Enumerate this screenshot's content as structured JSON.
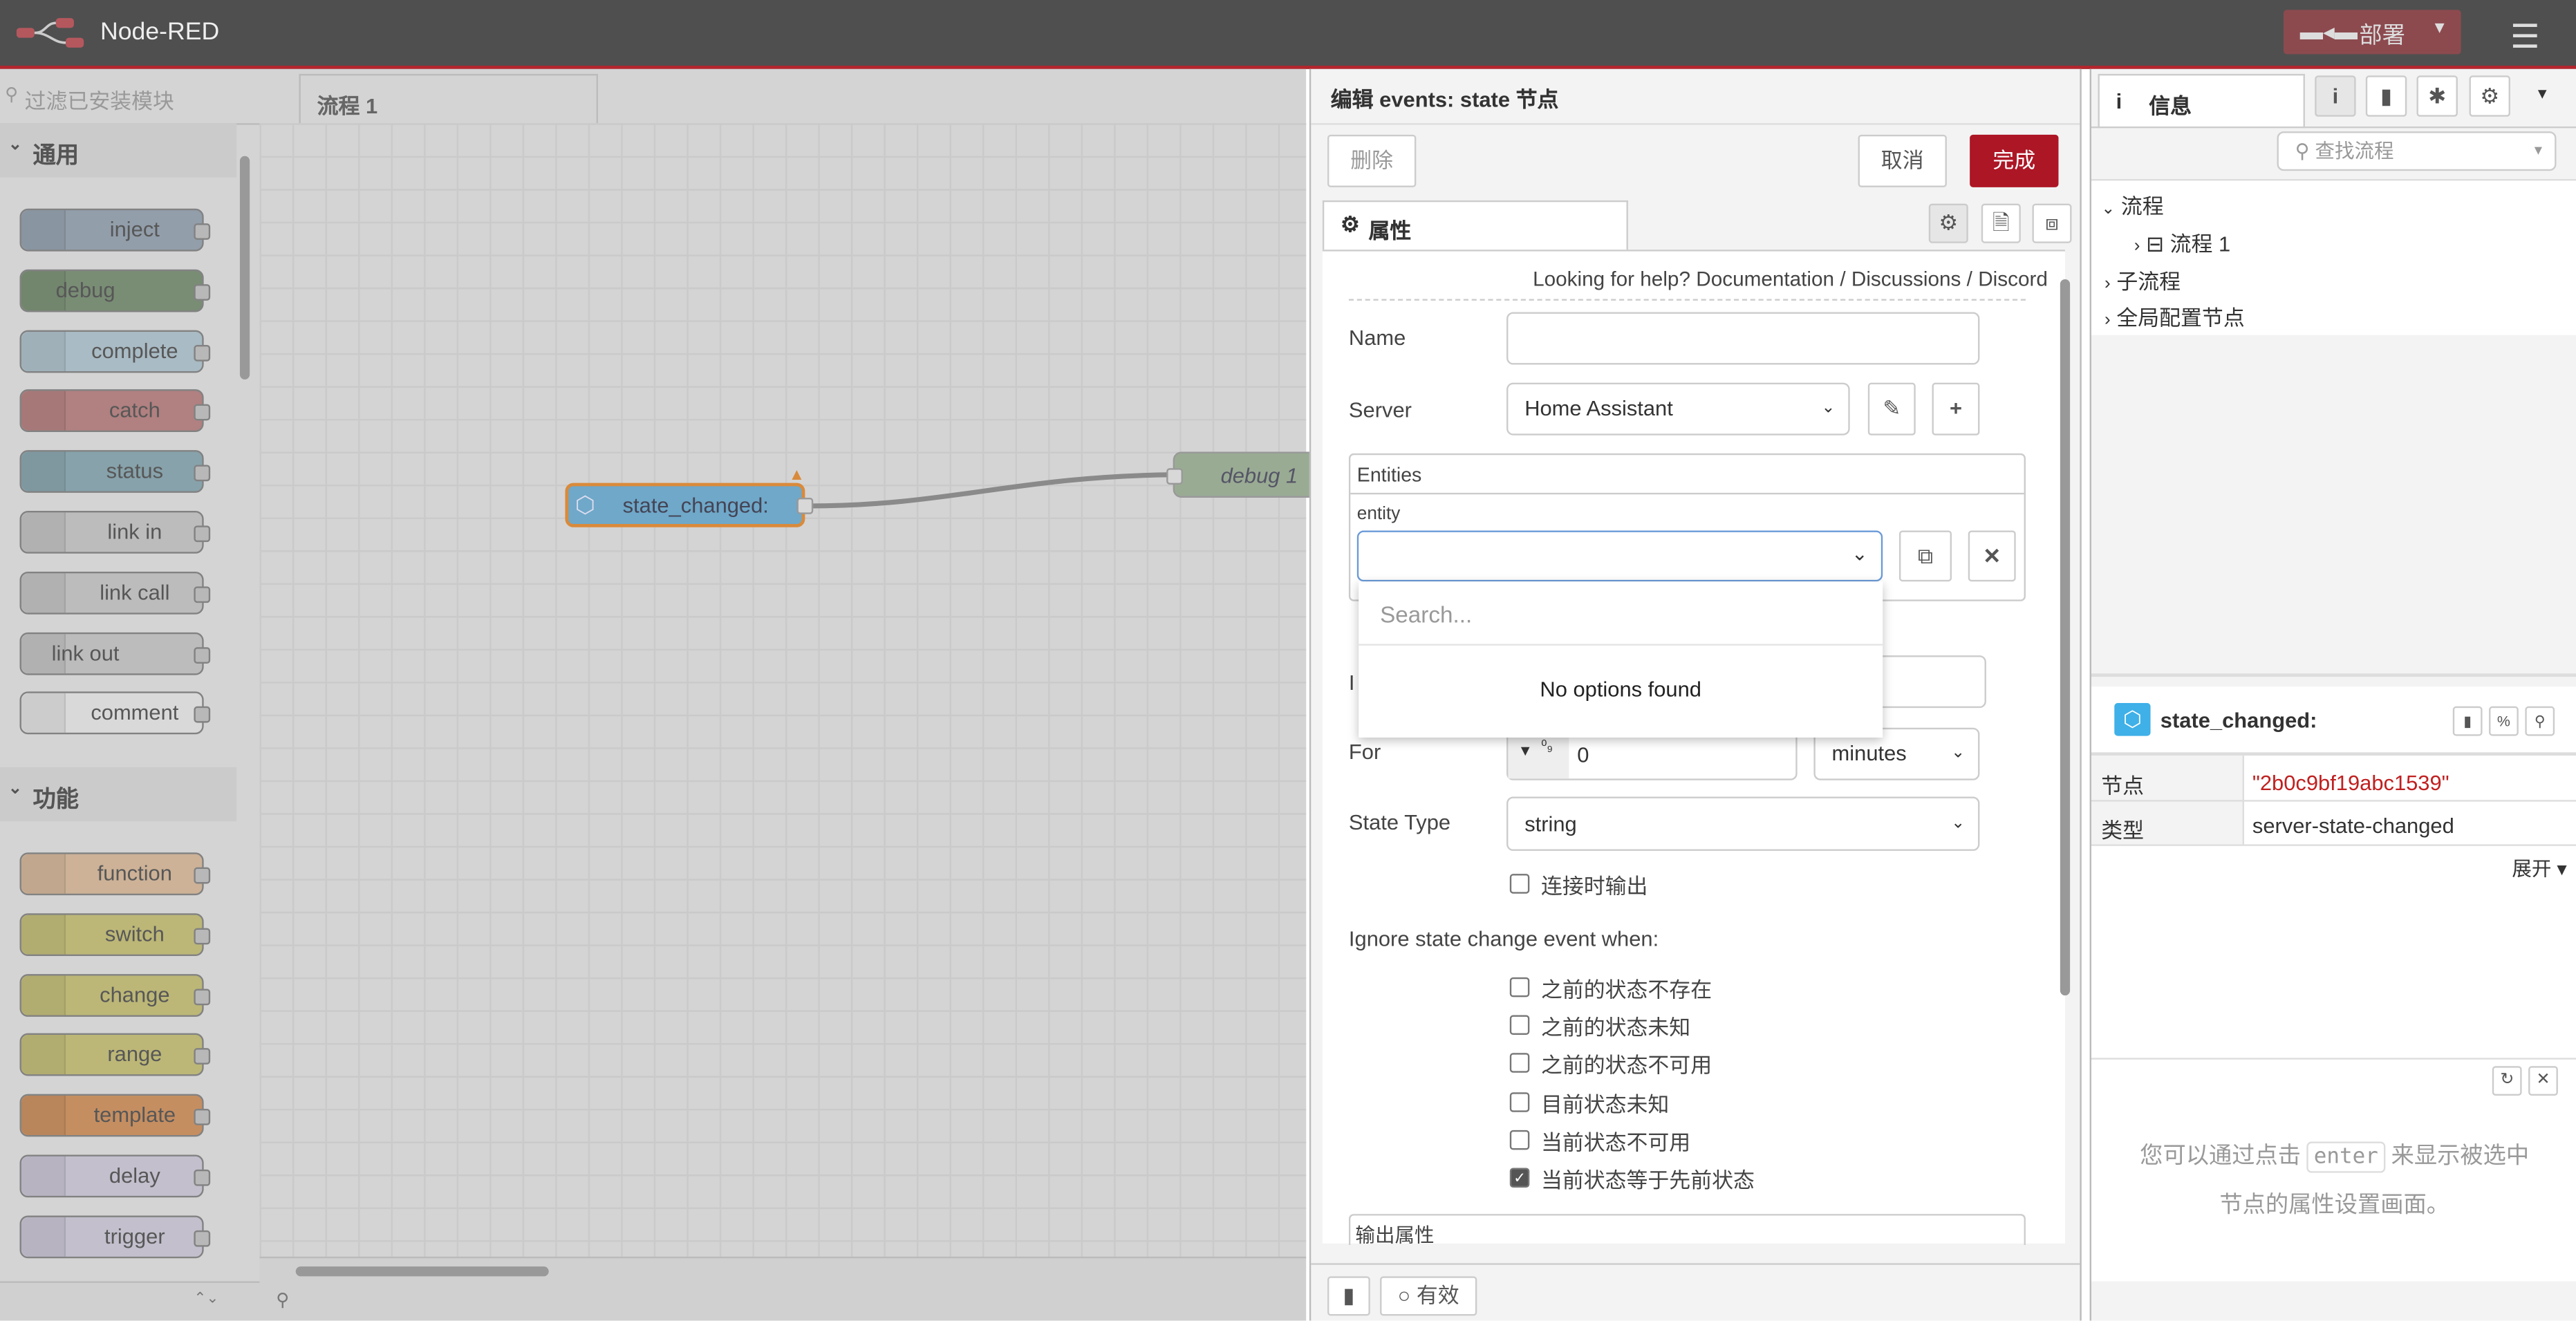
{
  "header": {
    "app_title": "Node-RED",
    "deploy_label": "部署",
    "brand_color": "#8c4a4f"
  },
  "palette": {
    "search_placeholder": "过滤已安装模块",
    "categories": [
      {
        "label": "通用"
      },
      {
        "label": "功能"
      }
    ],
    "common_nodes": [
      {
        "label": "inject",
        "color": "#a6bbcf"
      },
      {
        "label": "debug",
        "color": "#87a980"
      },
      {
        "label": "complete",
        "color": "#c0deed"
      },
      {
        "label": "catch",
        "color": "#e49191"
      },
      {
        "label": "status",
        "color": "#94c1d0"
      },
      {
        "label": "link in",
        "color": "#dddddd"
      },
      {
        "label": "link call",
        "color": "#dddddd"
      },
      {
        "label": "link out",
        "color": "#dddddd"
      },
      {
        "label": "comment",
        "color": "#ffffff"
      }
    ],
    "function_nodes": [
      {
        "label": "function",
        "color": "#fdd0a2"
      },
      {
        "label": "switch",
        "color": "#e2d96e"
      },
      {
        "label": "change",
        "color": "#e2d96e"
      },
      {
        "label": "range",
        "color": "#e2d96e"
      },
      {
        "label": "template",
        "color": "#ffa357"
      },
      {
        "label": "delay",
        "color": "#e6e0f8"
      },
      {
        "label": "trigger",
        "color": "#e6e0f8"
      }
    ]
  },
  "workspace": {
    "tab_label": "流程 1",
    "nodes": [
      {
        "label": "state_changed:"
      },
      {
        "label": "debug 1"
      }
    ]
  },
  "editor": {
    "title": "编辑 events: state 节点",
    "delete_label": "删除",
    "cancel_label": "取消",
    "done_label": "完成",
    "tab_properties": "属性",
    "help": {
      "prefix": "Looking for help?",
      "documentation": "Documentation",
      "sep": "/",
      "discussions": "Discussions",
      "discord": "Discord"
    },
    "name_label": "Name",
    "name_value": "",
    "server_label": "Server",
    "server_value": "Home Assistant",
    "entities_label": "Entities",
    "entity_label": "entity",
    "entity_value": "",
    "search_placeholder": "Search...",
    "no_options": "No options found",
    "for_label": "For",
    "for_value": "0",
    "for_unit": "minutes",
    "state_type_label": "State Type",
    "state_type_value": "string",
    "output_on_connect": {
      "label": "连接时输出",
      "checked": false
    },
    "ignore_label": "Ignore state change event when:",
    "ignore_options": [
      {
        "label": "之前的状态不存在",
        "checked": false
      },
      {
        "label": "之前的状态未知",
        "checked": false
      },
      {
        "label": "之前的状态不可用",
        "checked": false
      },
      {
        "label": "目前状态未知",
        "checked": false
      },
      {
        "label": "当前状态不可用",
        "checked": false
      },
      {
        "label": "当前状态等于先前状态",
        "checked": true
      }
    ],
    "output_props_label": "输出属性",
    "enabled_label": "有效"
  },
  "sidebar": {
    "tab_label": "信息",
    "search_placeholder": "查找流程",
    "tree": [
      {
        "label": "流程"
      },
      {
        "label": "流程 1"
      },
      {
        "label": "子流程"
      },
      {
        "label": "全局配置节点"
      }
    ],
    "node_title": "state_changed:",
    "props": [
      {
        "key": "节点",
        "value": "\"2b0c9bf19abc1539\""
      },
      {
        "key": "类型",
        "value": "server-state-changed"
      }
    ],
    "expand_label": "展开",
    "tip_before": "您可以通过点击",
    "tip_key": "enter",
    "tip_after": "来显示被选中",
    "tip_line2": "节点的属性设置画面。"
  }
}
